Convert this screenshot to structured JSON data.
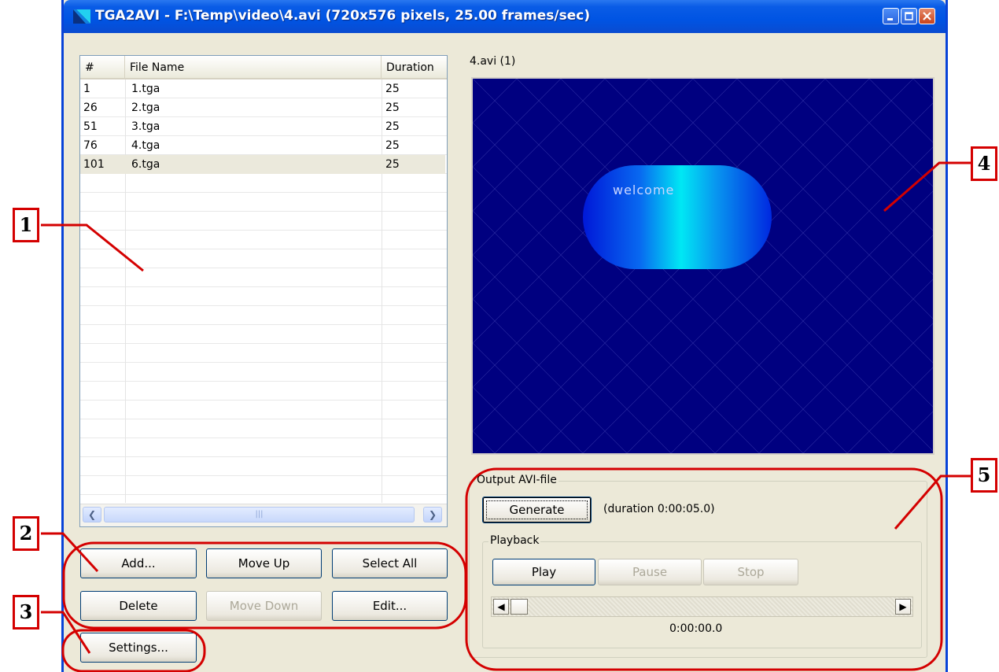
{
  "window": {
    "title": "TGA2AVI - F:\\Temp\\video\\4.avi (720x576 pixels, 25.00 frames/sec)"
  },
  "file_list": {
    "columns": [
      "#",
      "File Name",
      "Duration"
    ],
    "rows": [
      {
        "num": "1",
        "name": "1.tga",
        "duration": "25"
      },
      {
        "num": "26",
        "name": "2.tga",
        "duration": "25"
      },
      {
        "num": "51",
        "name": "3.tga",
        "duration": "25"
      },
      {
        "num": "76",
        "name": "4.tga",
        "duration": "25"
      },
      {
        "num": "101",
        "name": "6.tga",
        "duration": "25"
      }
    ],
    "selected_index": 4
  },
  "list_buttons": {
    "add": "Add...",
    "move_up": "Move Up",
    "select_all": "Select All",
    "delete": "Delete",
    "move_down": "Move Down",
    "edit": "Edit...",
    "settings": "Settings..."
  },
  "preview": {
    "label": "4.avi (1)",
    "frame_text": "welcome",
    "background_color": "#000080"
  },
  "output": {
    "group_label": "Output AVI-file",
    "generate": "Generate",
    "duration_text": "(duration 0:00:05.0)",
    "playback_label": "Playback",
    "play": "Play",
    "pause": "Pause",
    "stop": "Stop",
    "position": 0,
    "timecode": "0:00:00.0"
  },
  "callouts": {
    "c1": "1",
    "c2": "2",
    "c3": "3",
    "c4": "4",
    "c5": "5",
    "color": "#d40000"
  }
}
